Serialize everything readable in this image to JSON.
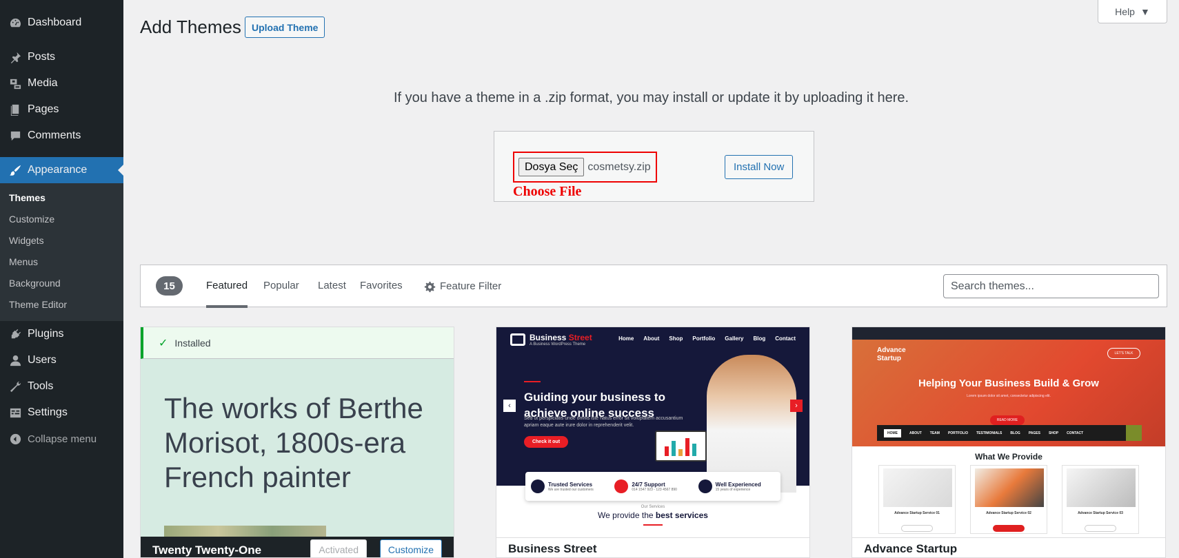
{
  "sidebar": {
    "items": [
      {
        "label": "Dashboard",
        "icon": "dashboard-icon"
      },
      {
        "label": "Posts",
        "icon": "pin-icon"
      },
      {
        "label": "Media",
        "icon": "media-icon"
      },
      {
        "label": "Pages",
        "icon": "pages-icon"
      },
      {
        "label": "Comments",
        "icon": "comment-icon"
      },
      {
        "label": "Appearance",
        "icon": "brush-icon"
      },
      {
        "label": "Plugins",
        "icon": "plugin-icon"
      },
      {
        "label": "Users",
        "icon": "user-icon"
      },
      {
        "label": "Tools",
        "icon": "wrench-icon"
      },
      {
        "label": "Settings",
        "icon": "settings-icon"
      }
    ],
    "appearance_submenu": [
      "Themes",
      "Customize",
      "Widgets",
      "Menus",
      "Background",
      "Theme Editor"
    ],
    "collapse_label": "Collapse menu",
    "active_color": "#2271b1"
  },
  "header": {
    "help_label": "Help",
    "title": "Add Themes",
    "upload_button": "Upload Theme"
  },
  "upload": {
    "help_text": "If you have a theme in a .zip format, you may install or update it by uploading it here.",
    "file_button": "Dosya Seç",
    "file_name": "cosmetsy.zip",
    "annotation": "Choose File",
    "install_button": "Install Now"
  },
  "filter": {
    "count": "15",
    "tabs": [
      "Featured",
      "Popular",
      "Latest",
      "Favorites"
    ],
    "feature_filter": "Feature Filter",
    "search_placeholder": "Search themes..."
  },
  "themes": [
    {
      "name": "Twenty Twenty-One",
      "installed_label": "Installed",
      "preview_text": "The works of Berthe Morisot, 1800s-era French painter",
      "activated_label": "Activated",
      "customize_label": "Customize"
    },
    {
      "name": "Business Street",
      "logo_word1": "Business",
      "logo_word2": "Street",
      "tagline": "A Business WordPress Theme",
      "nav": [
        "Home",
        "About",
        "Shop",
        "Portfolio",
        "Gallery",
        "Blog",
        "Contact"
      ],
      "headline": "Guiding your business to achieve online success",
      "sub": "Sed ut perspiciatis unde omnis iste natus error sit voluptatem accusantium apriam eaque aute irure dolor in reprehenderit velit.",
      "cta": "Check it out",
      "features": [
        {
          "title": "Trusted Services",
          "sub": "We are trusted our customers"
        },
        {
          "title": "24/7 Support",
          "sub": "014 1547 923 - 123 4567 890"
        },
        {
          "title": "Well Experienced",
          "sub": "15 years of experience"
        }
      ],
      "services_kicker": "Our Services",
      "services_title_pre": "We provide the",
      "services_title_post": "best services"
    },
    {
      "name": "Advance Startup",
      "logo": "Advance Startup",
      "talk_button": "LET'S TALK",
      "headline": "Helping Your Business Build & Grow",
      "sub": "Lorem ipsum dolor sit amet, consectetur adipiscing elit.",
      "cta": "READ MORE",
      "nav": [
        "HOME",
        "ABOUT",
        "TEAM",
        "PORTFOLIO",
        "TESTIMONIALS",
        "BLOG",
        "PAGES",
        "SHOP",
        "CONTACT"
      ],
      "section_title": "What We Provide",
      "services": [
        "Advance Startup Service 01",
        "Advance Startup Service 02",
        "Advance Startup Service 03"
      ]
    }
  ]
}
